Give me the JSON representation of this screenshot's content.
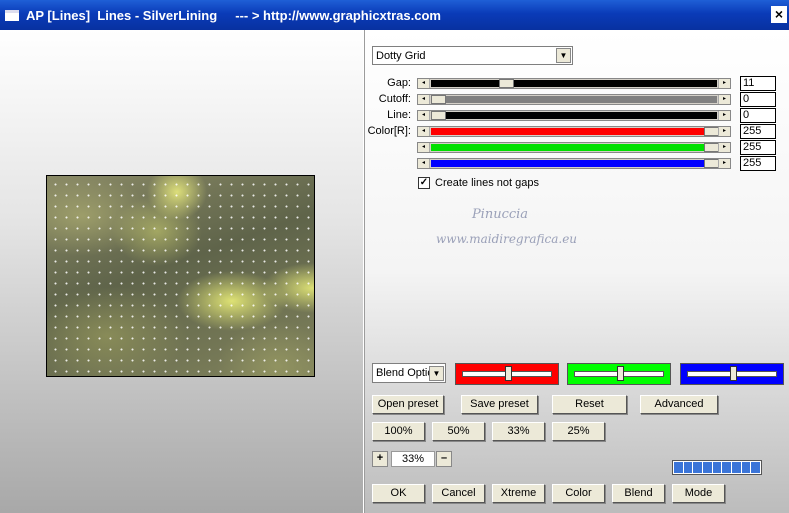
{
  "window": {
    "title": "AP [Lines]  Lines - SilverLining     --- > http://www.graphicxtras.com",
    "close_label": "×"
  },
  "preview": {
    "pattern": "dotty grid preview"
  },
  "mode_select": {
    "value": "Dotty Grid"
  },
  "params": [
    {
      "label": "Gap:",
      "value": "11",
      "track_color": "#000000",
      "fraction": 0.25
    },
    {
      "label": "Cutoff:",
      "value": "0",
      "track_color": "#808080",
      "fraction": 0.0
    },
    {
      "label": "Line:",
      "value": "0",
      "track_color": "#000000",
      "fraction": 0.0
    },
    {
      "label": "Color[R]:",
      "value": "255",
      "track_color": "#ff0000",
      "fraction": 1.0
    },
    {
      "label": "",
      "value": "255",
      "track_color": "#00e000",
      "fraction": 1.0
    },
    {
      "label": "",
      "value": "255",
      "track_color": "#0000ff",
      "fraction": 1.0
    }
  ],
  "checkbox": {
    "checked_mark": "✓",
    "label": "Create lines not gaps"
  },
  "watermark": {
    "line1": "Pinuccia",
    "line2": "www.maidiregrafica.eu"
  },
  "blend_select": {
    "value": "Blend Optio"
  },
  "color_panels": [
    {
      "color": "#ff0000",
      "fraction": 0.5
    },
    {
      "color": "#00ff00",
      "fraction": 0.5
    },
    {
      "color": "#0000ff",
      "fraction": 0.5
    }
  ],
  "preset_buttons": [
    "Open preset",
    "Save preset",
    "Reset",
    "Advanced"
  ],
  "zoom_buttons": [
    "100%",
    "50%",
    "33%",
    "25%"
  ],
  "zoom": {
    "value": "33%",
    "plus": "+",
    "minus": "–"
  },
  "progress": {
    "segments": 9
  },
  "bottom_buttons": [
    "OK",
    "Cancel",
    "Xtreme",
    "Color",
    "Blend",
    "Mode"
  ]
}
